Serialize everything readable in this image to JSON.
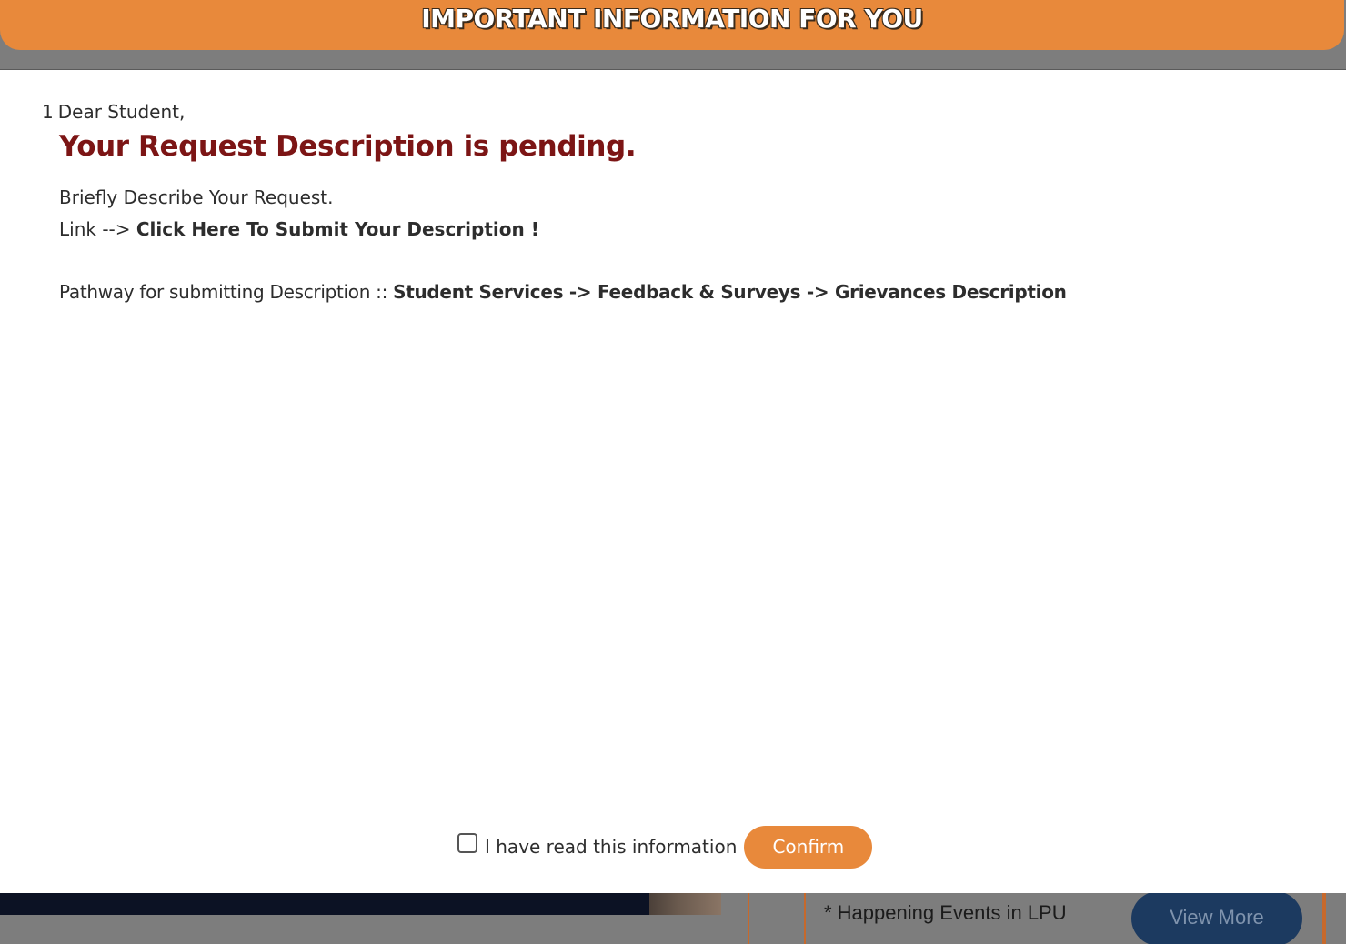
{
  "header": {
    "title": "IMPORTANT INFORMATION FOR YOU"
  },
  "notice": {
    "number": "1",
    "greeting": "Dear Student,",
    "heading": "Your Request Description is pending.",
    "describe": "Briefly Describe Your Request.",
    "link_prefix": "Link -->",
    "link_text": "Click Here To Submit Your Description !",
    "pathway_prefix": "Pathway for submitting Description ::",
    "pathway_value": "Student Services -> Feedback & Surveys -> Grievances Description"
  },
  "footer": {
    "checkbox_label": "I have read this information",
    "checkbox_checked": false,
    "confirm_label": "Confirm"
  },
  "background": {
    "events_text": "* Happening Events in LPU",
    "view_more_label": "View More"
  },
  "colors": {
    "accent": "#e8893b",
    "heading": "#7c1515",
    "overlay": "#7d7d7d"
  }
}
